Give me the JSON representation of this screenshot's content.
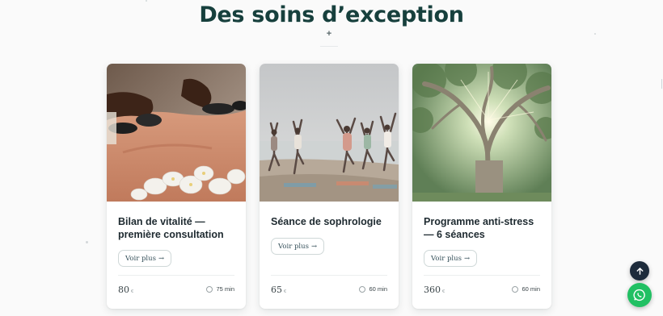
{
  "section": {
    "title": "Des soins d’exception",
    "ornament": "+"
  },
  "cards": [
    {
      "title_lines": [
        "Bilan de vitalité —",
        "première consultation"
      ],
      "button_label": "Voir plus",
      "button_arrow": "→",
      "price": "80",
      "currency": "€",
      "duration": "75 min",
      "image": "hot-stone-massage-photo"
    },
    {
      "title_lines": [
        "Séance de sophrologie"
      ],
      "button_label": "Voir plus",
      "button_arrow": "→",
      "price": "65",
      "currency": "€",
      "duration": "60 min",
      "image": "beach-yoga-group-photo"
    },
    {
      "title_lines": [
        "Programme anti-stress",
        "— 6 séances"
      ],
      "button_label": "Voir plus",
      "button_arrow": "→",
      "price": "360",
      "currency": "€",
      "duration": "60 min",
      "image": "giant-tree-sunlight-photo"
    }
  ],
  "floating": {
    "scroll_top_icon": "arrow-up-icon",
    "whatsapp_icon": "whatsapp-icon",
    "colors": {
      "scroll_top": "#1d2b3b",
      "whatsapp": "#21c063"
    }
  },
  "colors": {
    "heading": "#17403d",
    "background": "#fafafa"
  }
}
